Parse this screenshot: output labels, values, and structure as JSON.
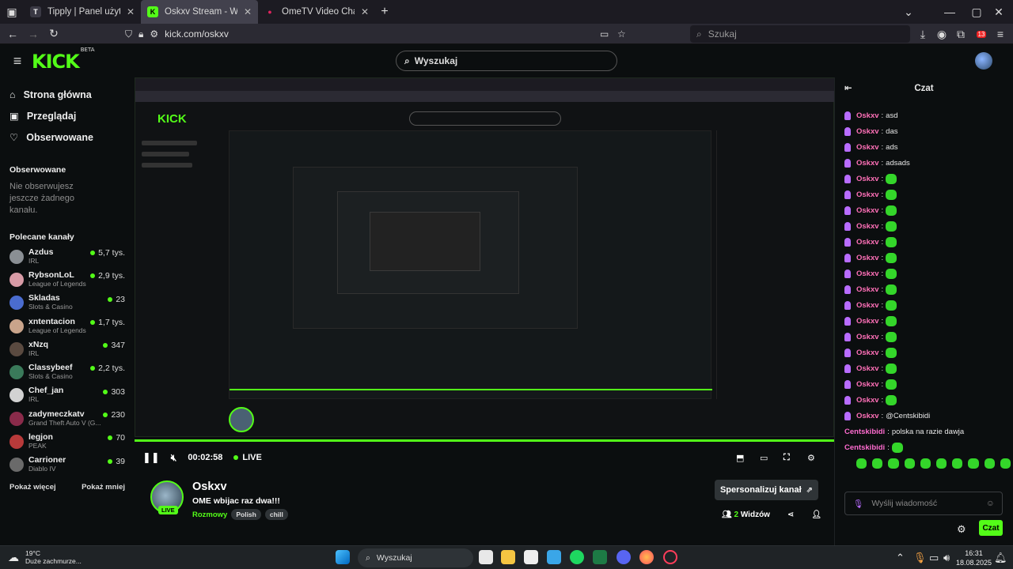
{
  "browser": {
    "tabs": [
      {
        "title": "Tipply | Panel użytkownika",
        "fav_color": "#2b2a33",
        "fav_glyph": "T"
      },
      {
        "title": "Oskxv Stream - Watch Live on Kick",
        "fav_color": "#53fc18",
        "fav_glyph": "K"
      },
      {
        "title": "OmeTV Video Chat — Omegle",
        "fav_color": "#e0245e",
        "fav_glyph": "●"
      }
    ],
    "new_tab": "+",
    "url": "kick.com/oskxv",
    "search_placeholder": "Szukaj",
    "notif_badge": "13"
  },
  "kick": {
    "logo": "KICK",
    "logo_sup": "BETA",
    "search_placeholder": "Wyszukaj"
  },
  "sidebar": {
    "nav": [
      {
        "label": "Strona główna",
        "icon": "home-icon"
      },
      {
        "label": "Przeglądaj",
        "icon": "browse-icon"
      },
      {
        "label": "Obserwowane",
        "icon": "heart-icon"
      }
    ],
    "followed_heading": "Obserwowane",
    "followed_empty": "Nie obserwujesz jeszcze żadnego kanału.",
    "recommended_heading": "Polecane kanały",
    "channels": [
      {
        "name": "Azdus",
        "category": "IRL",
        "viewers": "5,7 tys.",
        "color": "#8a8f94"
      },
      {
        "name": "RybsonLoL",
        "category": "League of Legends",
        "viewers": "2,9 tys.",
        "color": "#d89ba6"
      },
      {
        "name": "Skladas",
        "category": "Slots & Casino",
        "viewers": "23",
        "color": "#4a6ccf"
      },
      {
        "name": "xntentacion",
        "category": "League of Legends",
        "viewers": "1,7 tys.",
        "color": "#c9a48b"
      },
      {
        "name": "xNzq",
        "category": "IRL",
        "viewers": "347",
        "color": "#5a4a40"
      },
      {
        "name": "Classybeef",
        "category": "Slots & Casino",
        "viewers": "2,2 tys.",
        "color": "#3a7a5a"
      },
      {
        "name": "Chef_jan",
        "category": "IRL",
        "viewers": "303",
        "color": "#d2d2d2"
      },
      {
        "name": "zadymeczkatv",
        "category": "Grand Theft Auto V (G...",
        "viewers": "230",
        "color": "#8a2b4a"
      },
      {
        "name": "legjon",
        "category": "PEAK",
        "viewers": "70",
        "color": "#b83a3a"
      },
      {
        "name": "Carrioner",
        "category": "Diablo IV",
        "viewers": "39",
        "color": "#6a6a6a"
      }
    ],
    "show_more": "Pokaż więcej",
    "show_less": "Pokaż mniej"
  },
  "player": {
    "time": "00:02:58",
    "live_label": "LIVE"
  },
  "channel": {
    "name": "Oskxv",
    "live_badge": "LIVE",
    "title": "OME wbijac raz dwa!!!",
    "category": "Rozmowy",
    "tags": [
      "Polish",
      "chill"
    ],
    "customize_button": "Spersonalizuj kanał",
    "viewers": "2",
    "viewers_label": "Widzów"
  },
  "chat": {
    "title": "Czat",
    "messages": [
      {
        "user": "Oskxv",
        "text": "asd",
        "emote": false
      },
      {
        "user": "Oskxv",
        "text": "das",
        "emote": false
      },
      {
        "user": "Oskxv",
        "text": "ads",
        "emote": false
      },
      {
        "user": "Oskxv",
        "text": "adsads",
        "emote": false
      },
      {
        "user": "Oskxv",
        "text": "",
        "emote": true
      },
      {
        "user": "Oskxv",
        "text": "",
        "emote": true
      },
      {
        "user": "Oskxv",
        "text": "",
        "emote": true
      },
      {
        "user": "Oskxv",
        "text": "",
        "emote": true
      },
      {
        "user": "Oskxv",
        "text": "",
        "emote": true
      },
      {
        "user": "Oskxv",
        "text": "",
        "emote": true
      },
      {
        "user": "Oskxv",
        "text": "",
        "emote": true
      },
      {
        "user": "Oskxv",
        "text": "",
        "emote": true
      },
      {
        "user": "Oskxv",
        "text": "",
        "emote": true
      },
      {
        "user": "Oskxv",
        "text": "",
        "emote": true
      },
      {
        "user": "Oskxv",
        "text": "",
        "emote": true
      },
      {
        "user": "Oskxv",
        "text": "",
        "emote": true
      },
      {
        "user": "Oskxv",
        "text": "",
        "emote": true
      },
      {
        "user": "Oskxv",
        "text": "",
        "emote": true
      },
      {
        "user": "Oskxv",
        "text": "",
        "emote": true
      },
      {
        "user": "Oskxv",
        "text": "@Centskibidi",
        "emote": false
      }
    ],
    "msg_user2": "Centskibidi",
    "msg_user2_text": "polska na razie dawja",
    "input_placeholder": "Wyślij wiadomość",
    "send_button": "Czat"
  },
  "taskbar": {
    "temperature": "19°C",
    "weather": "Duże zachmurze...",
    "search_placeholder": "Wyszukaj",
    "time": "16:31",
    "date": "18.08.2025"
  }
}
